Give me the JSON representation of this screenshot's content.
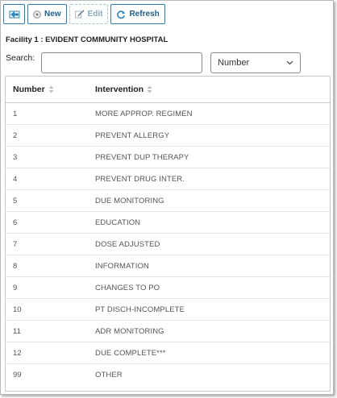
{
  "toolbar": {
    "new_label": "New",
    "edit_label": "Edit",
    "refresh_label": "Refresh"
  },
  "facility_title": "Facility 1 : EVIDENT COMMUNITY HOSPITAL",
  "search": {
    "label": "Search:",
    "value": "",
    "placeholder": "",
    "column_selected": "Number"
  },
  "table": {
    "columns": [
      "Number",
      "Intervention"
    ],
    "rows": [
      {
        "number": "1",
        "intervention": "MORE APPROP. REGIMEN"
      },
      {
        "number": "2",
        "intervention": "PREVENT ALLERGY"
      },
      {
        "number": "3",
        "intervention": "PREVENT DUP THERAPY"
      },
      {
        "number": "4",
        "intervention": "PREVENT DRUG INTER."
      },
      {
        "number": "5",
        "intervention": "DUE MONITORING"
      },
      {
        "number": "6",
        "intervention": "EDUCATION"
      },
      {
        "number": "7",
        "intervention": "DOSE ADJUSTED"
      },
      {
        "number": "8",
        "intervention": "INFORMATION"
      },
      {
        "number": "9",
        "intervention": "CHANGES TO PO"
      },
      {
        "number": "10",
        "intervention": "PT DISCH-INCOMPLETE"
      },
      {
        "number": "11",
        "intervention": "ADR MONITORING"
      },
      {
        "number": "12",
        "intervention": "DUE COMPLETE***"
      },
      {
        "number": "99",
        "intervention": "OTHER"
      }
    ]
  },
  "colors": {
    "accent": "#1f5f86",
    "button_border": "#2f7fa8",
    "disabled": "#8aa9bd"
  },
  "icons": {
    "back": "back-arrow-icon",
    "new": "new-circle-icon",
    "edit": "edit-pencil-icon",
    "refresh": "refresh-icon",
    "sort": "sort-icon",
    "dropdown": "chevron-down-icon"
  }
}
